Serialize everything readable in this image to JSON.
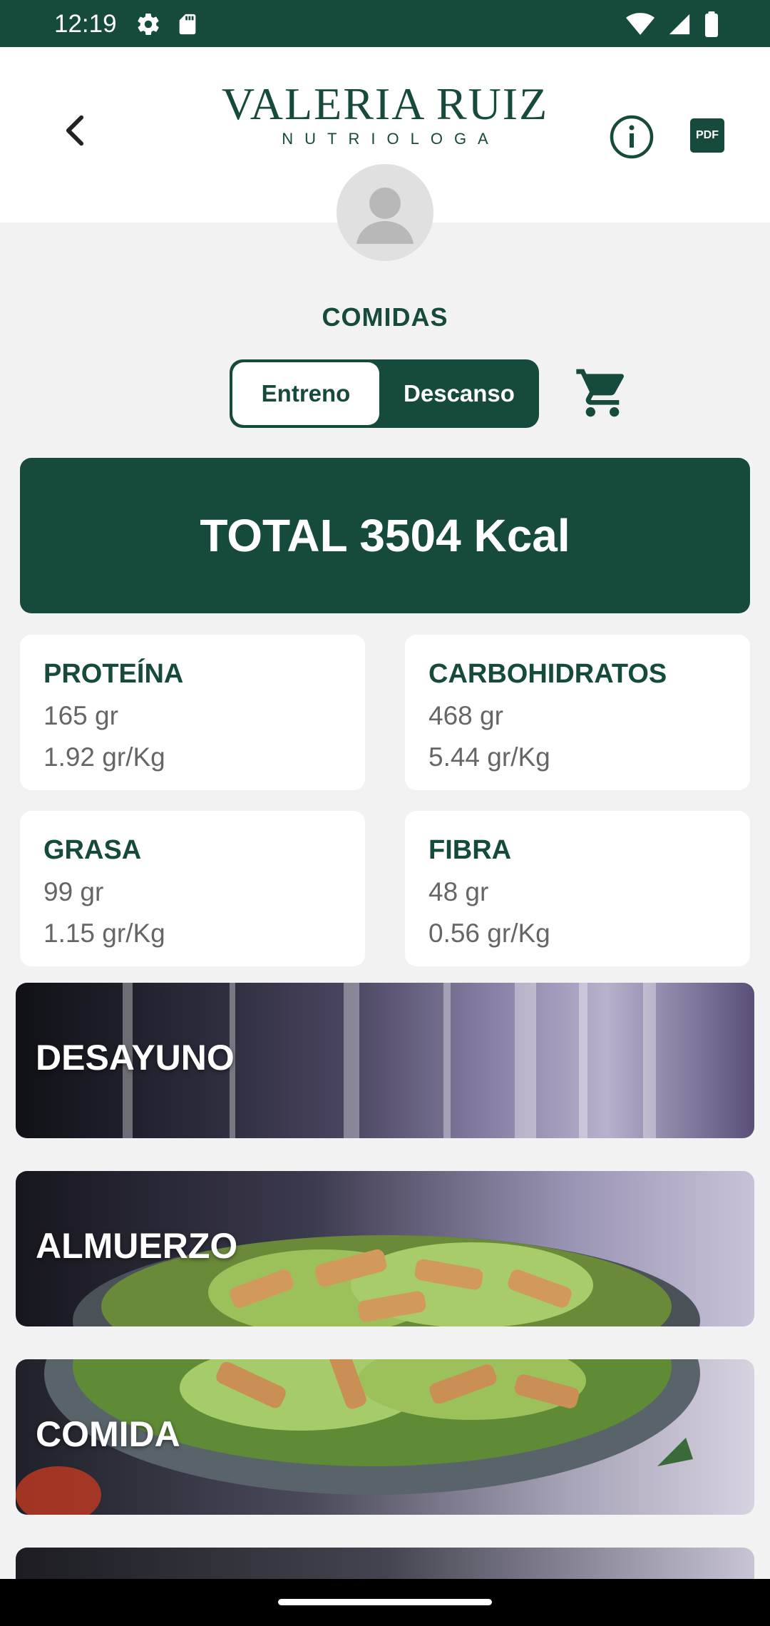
{
  "status_bar": {
    "time": "12:19",
    "icons": [
      "gear-icon",
      "sd-card-icon",
      "wifi-icon",
      "signal-icon",
      "battery-icon"
    ]
  },
  "header": {
    "logo_name": "VALERIA RUIZ",
    "logo_subtitle": "NUTRIOLOGA",
    "pdf_label": "PDF"
  },
  "main": {
    "section_title": "COMIDAS",
    "toggle": {
      "options": [
        "Entreno",
        "Descanso"
      ],
      "selected": "Entreno"
    },
    "total": "TOTAL  3504 Kcal",
    "macros": [
      {
        "title": "PROTEÍNA",
        "amount": "165 gr",
        "per_kg": "1.92 gr/Kg"
      },
      {
        "title": "CARBOHIDRATOS",
        "amount": "468 gr",
        "per_kg": "5.44 gr/Kg"
      },
      {
        "title": "GRASA",
        "amount": "99 gr",
        "per_kg": "1.15 gr/Kg"
      },
      {
        "title": "FIBRA",
        "amount": "48 gr",
        "per_kg": "0.56 gr/Kg"
      }
    ],
    "meals": [
      "DESAYUNO",
      "ALMUERZO",
      "COMIDA"
    ]
  },
  "colors": {
    "primary": "#164a3c",
    "background": "#f2f2f2",
    "card": "#ffffff"
  }
}
